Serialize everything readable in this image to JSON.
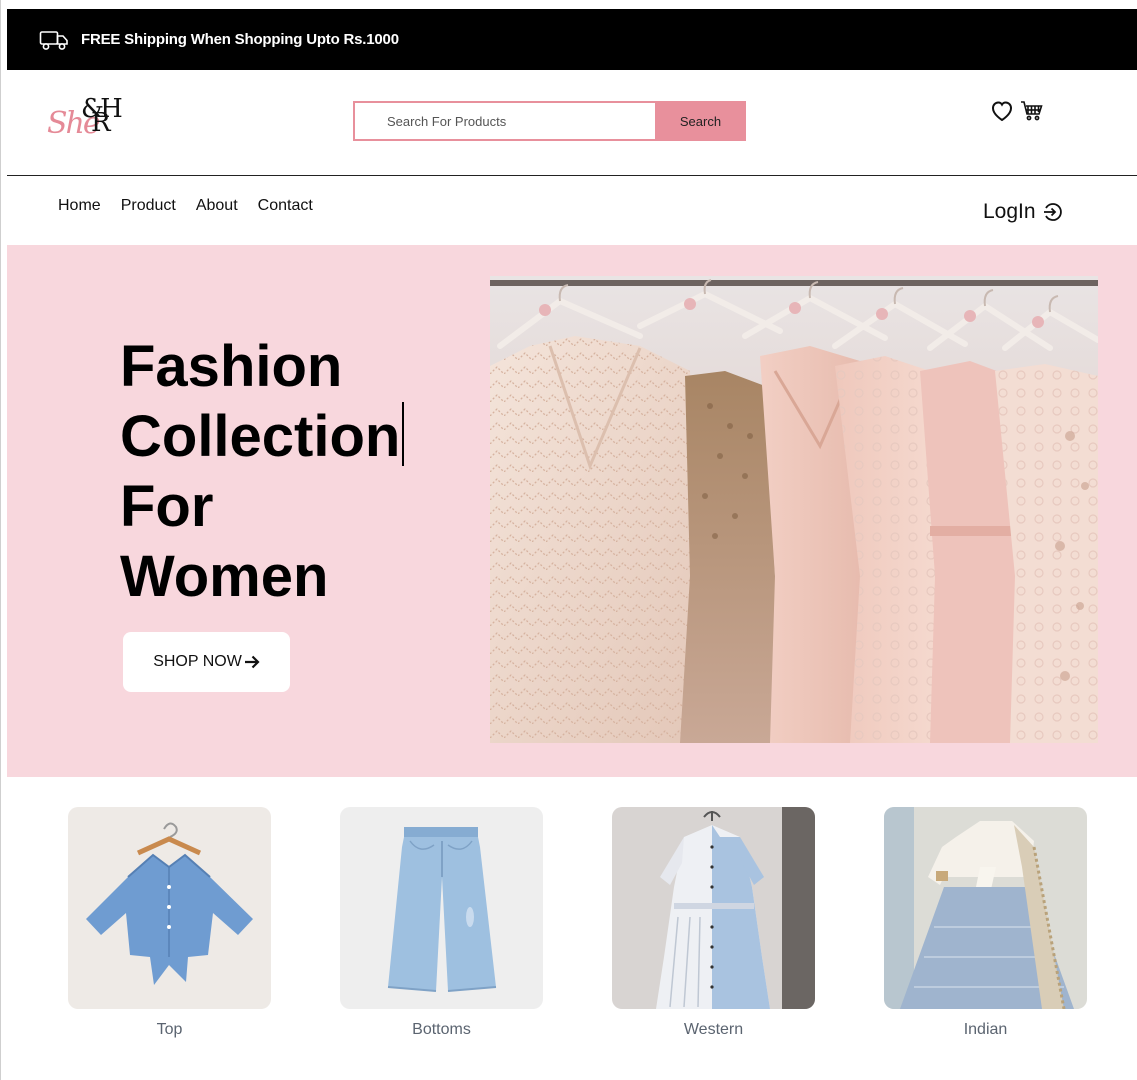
{
  "topbar": {
    "promo_text": "FREE Shipping When Shopping Upto Rs.1000",
    "icon": "truck-icon"
  },
  "header": {
    "logo_script": "She",
    "logo_mono": "&H",
    "logo_mono2": "R",
    "search": {
      "placeholder": "Search For Products",
      "value": "",
      "button_label": "Search"
    },
    "icons": [
      "heart-icon",
      "cart-icon"
    ]
  },
  "nav": {
    "items": [
      {
        "label": "Home"
      },
      {
        "label": "Product"
      },
      {
        "label": "About"
      },
      {
        "label": "Contact"
      }
    ],
    "login_label": "LogIn"
  },
  "hero": {
    "title_lines": [
      "Fashion",
      "Collection",
      "For",
      "Women"
    ],
    "cta_label": "SHOP NOW",
    "cta_icon": "arrow-right-icon",
    "image_icon": "dresses-on-rack-image"
  },
  "categories": [
    {
      "label": "Top"
    },
    {
      "label": "Bottoms"
    },
    {
      "label": "Western"
    },
    {
      "label": "Indian"
    }
  ],
  "colors": {
    "topbar_bg": "#000000",
    "accent_pink": "#e8909c",
    "hero_bg": "#f8d7dd"
  }
}
